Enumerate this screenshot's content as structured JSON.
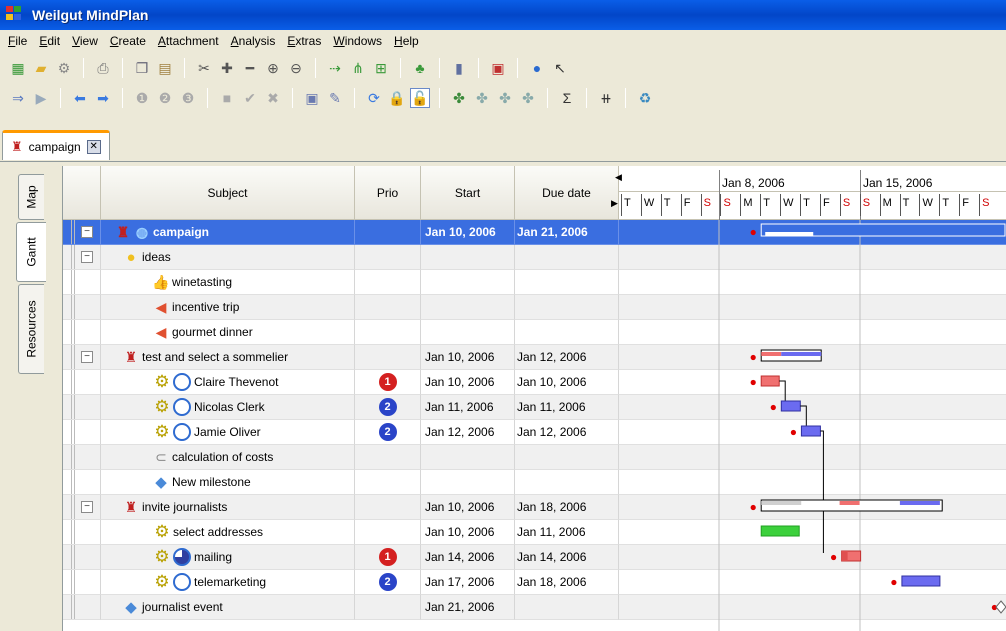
{
  "window": {
    "title": "Weilgut MindPlan"
  },
  "menu": [
    "File",
    "Edit",
    "View",
    "Create",
    "Attachment",
    "Analysis",
    "Extras",
    "Windows",
    "Help"
  ],
  "doc_tab": {
    "label": "campaign"
  },
  "side_tabs": [
    "Map",
    "Gantt",
    "Resources"
  ],
  "columns": {
    "subject": "Subject",
    "prio": "Prio",
    "start": "Start",
    "due": "Due date"
  },
  "gantt_header": {
    "weeks": [
      "Jan 8, 2006",
      "Jan 15, 2006"
    ],
    "days": [
      "T",
      "W",
      "T",
      "F",
      "S",
      "S",
      "M",
      "T",
      "W",
      "T",
      "F",
      "S",
      "S",
      "M",
      "T",
      "W",
      "T",
      "F",
      "S"
    ]
  },
  "rows": [
    {
      "subject": "campaign",
      "start": "Jan 10, 2006",
      "due": "Jan 21, 2006",
      "prio": ""
    },
    {
      "subject": "ideas",
      "start": "",
      "due": "",
      "prio": ""
    },
    {
      "subject": "winetasting",
      "start": "",
      "due": "",
      "prio": ""
    },
    {
      "subject": "incentive trip",
      "start": "",
      "due": "",
      "prio": ""
    },
    {
      "subject": "gourmet dinner",
      "start": "",
      "due": "",
      "prio": ""
    },
    {
      "subject": "test and select a sommelier",
      "start": "Jan 10, 2006",
      "due": "Jan 12, 2006",
      "prio": ""
    },
    {
      "subject": "Claire Thevenot",
      "start": "Jan 10, 2006",
      "due": "Jan 10, 2006",
      "prio": "1"
    },
    {
      "subject": "Nicolas Clerk",
      "start": "Jan 11, 2006",
      "due": "Jan 11, 2006",
      "prio": "2"
    },
    {
      "subject": "Jamie Oliver",
      "start": "Jan 12, 2006",
      "due": "Jan 12, 2006",
      "prio": "2"
    },
    {
      "subject": "calculation of costs",
      "start": "",
      "due": "",
      "prio": ""
    },
    {
      "subject": "New milestone",
      "start": "",
      "due": "",
      "prio": ""
    },
    {
      "subject": "invite journalists",
      "start": "Jan 10, 2006",
      "due": "Jan 18, 2006",
      "prio": ""
    },
    {
      "subject": "select addresses",
      "start": "Jan 10, 2006",
      "due": "Jan 11, 2006",
      "prio": ""
    },
    {
      "subject": "mailing",
      "start": "Jan 14, 2006",
      "due": "Jan 14, 2006",
      "prio": "1"
    },
    {
      "subject": "telemarketing",
      "start": "Jan 17, 2006",
      "due": "Jan 18, 2006",
      "prio": "2"
    },
    {
      "subject": "journalist event",
      "start": "Jan 21, 2006",
      "due": "",
      "prio": ""
    }
  ],
  "colors": {
    "selection": "#3a6ee0",
    "prio1": "#d42020",
    "prio2": "#2a44c8",
    "bar_blue": "#6b6bf0",
    "bar_red": "#f07070",
    "bar_green": "#3cd03c"
  }
}
